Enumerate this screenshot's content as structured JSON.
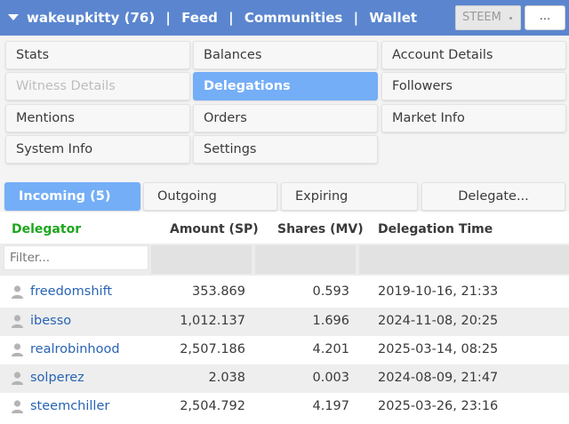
{
  "header": {
    "account": "wakeupkitty (76)",
    "separator": "|",
    "links": [
      "Feed",
      "Communities",
      "Wallet"
    ],
    "chain_select": "STEEM",
    "more_label": "..."
  },
  "menu": {
    "items": [
      {
        "label": "Stats",
        "state": "normal"
      },
      {
        "label": "Balances",
        "state": "normal"
      },
      {
        "label": "Account Details",
        "state": "normal"
      },
      {
        "label": "Witness Details",
        "state": "disabled"
      },
      {
        "label": "Delegations",
        "state": "active"
      },
      {
        "label": "Followers",
        "state": "normal"
      },
      {
        "label": "Mentions",
        "state": "normal"
      },
      {
        "label": "Orders",
        "state": "normal"
      },
      {
        "label": "Market Info",
        "state": "normal"
      },
      {
        "label": "System Info",
        "state": "normal"
      },
      {
        "label": "Settings",
        "state": "normal"
      }
    ]
  },
  "tabs": {
    "incoming": "Incoming (5)",
    "outgoing": "Outgoing",
    "expiring": "Expiring",
    "delegate": "Delegate..."
  },
  "table": {
    "headers": {
      "delegator": "Delegator",
      "amount": "Amount (SP)",
      "shares": "Shares (MV)",
      "time": "Delegation Time"
    },
    "filter_placeholder": "Filter...",
    "rows": [
      {
        "delegator": "freedomshift",
        "amount": "353.869",
        "shares": "0.593",
        "time": "2019-10-16, 21:33"
      },
      {
        "delegator": "ibesso",
        "amount": "1,012.137",
        "shares": "1.696",
        "time": "2024-11-08, 20:25"
      },
      {
        "delegator": "realrobinhood",
        "amount": "2,507.186",
        "shares": "4.201",
        "time": "2025-03-14, 08:25"
      },
      {
        "delegator": "solperez",
        "amount": "2.038",
        "shares": "0.003",
        "time": "2024-08-09, 21:47"
      },
      {
        "delegator": "steemchiller",
        "amount": "2,504.792",
        "shares": "4.197",
        "time": "2025-03-26, 23:16"
      }
    ]
  },
  "colors": {
    "header_bg": "#5b86cf",
    "active_bg": "#74aef7",
    "delegator_header": "#1ea51e",
    "link": "#2864b4"
  },
  "icons": {
    "header_caret": "caret-down-icon",
    "chain_dot": "dot-icon",
    "row_user": "user-icon"
  }
}
